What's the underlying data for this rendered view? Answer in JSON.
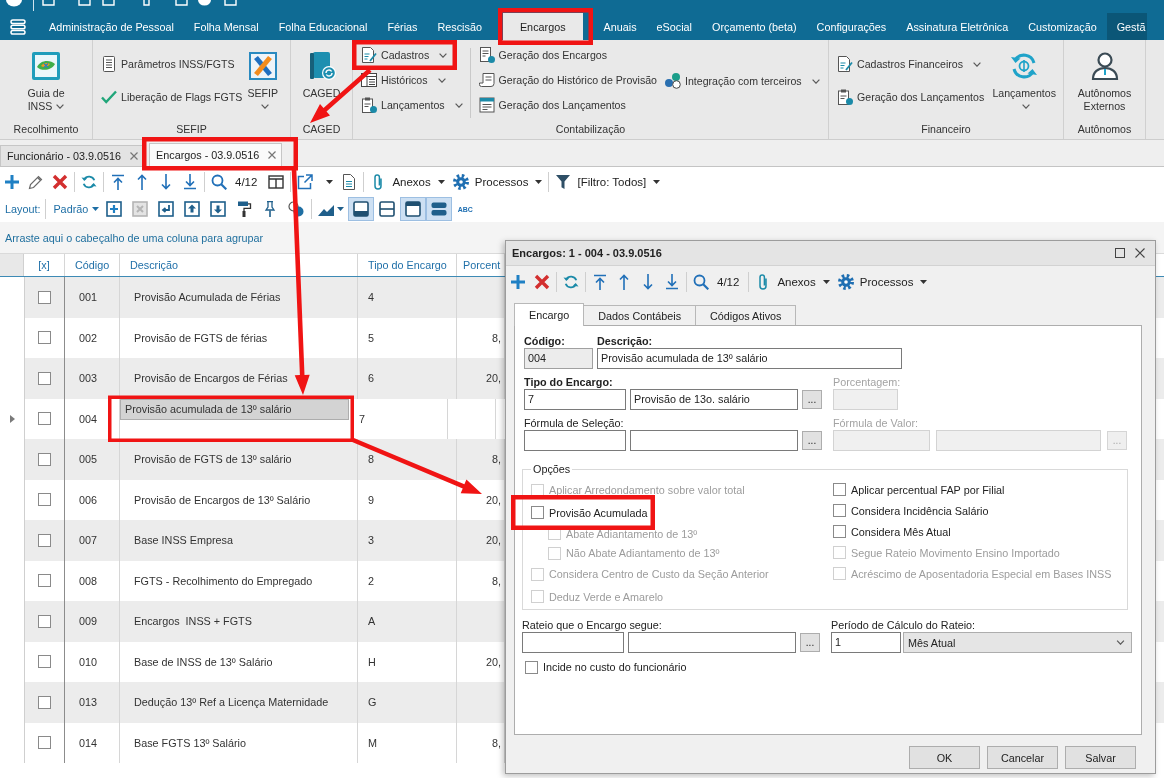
{
  "menu_tabs": [
    {
      "label": "Administração de Pessoal",
      "selected": false,
      "hovered": false
    },
    {
      "label": "Folha Mensal",
      "selected": false,
      "hovered": false
    },
    {
      "label": "Folha Educacional",
      "selected": false,
      "hovered": false
    },
    {
      "label": "Férias",
      "selected": false,
      "hovered": false
    },
    {
      "label": "Rescisão",
      "selected": false,
      "hovered": false
    },
    {
      "label": "Encargos",
      "selected": true,
      "hovered": false
    },
    {
      "label": "Anuais",
      "selected": false,
      "hovered": false
    },
    {
      "label": "eSocial",
      "selected": false,
      "hovered": false
    },
    {
      "label": "Orçamento (beta)",
      "selected": false,
      "hovered": false
    },
    {
      "label": "Configurações",
      "selected": false,
      "hovered": false
    },
    {
      "label": "Assinatura Eletrônica",
      "selected": false,
      "hovered": false
    },
    {
      "label": "Customização",
      "selected": false,
      "hovered": false
    },
    {
      "label": "Gestã",
      "selected": false,
      "hovered": true
    }
  ],
  "ribbon": {
    "recolhimento": {
      "label": "Recolhimento",
      "guia_inss": {
        "lines": [
          "Guia de",
          "INSS"
        ],
        "dropdown": true
      }
    },
    "sefip": {
      "label": "SEFIP",
      "parametros": {
        "label": "Parâmetros INSS/FGTS",
        "dropdown": false
      },
      "liberacao": {
        "label": "Liberação de Flags FGTS",
        "dropdown": false
      },
      "sefip": {
        "lines": [
          "SEFIP"
        ],
        "dropdown": true
      }
    },
    "caged": {
      "label": "CAGED",
      "caged": {
        "lines": [
          "CAGED"
        ],
        "dropdown": false
      }
    },
    "contabilizacao": {
      "label": "Contabilização",
      "cadastros": {
        "label": "Cadastros",
        "dropdown": true
      },
      "historicos": {
        "label": "Históricos",
        "dropdown": true
      },
      "lancamentos": {
        "label": "Lançamentos",
        "dropdown": true
      },
      "geracao_encargos": {
        "label": "Geração dos Encargos",
        "dropdown": false
      },
      "geracao_historico": {
        "label": "Geração do Histórico de Provisão",
        "dropdown": false
      },
      "geracao_lancamentos": {
        "label": "Geração dos Lançamentos",
        "dropdown": false
      },
      "integracao": {
        "label": "Integração com terceiros",
        "dropdown": true
      }
    },
    "financeiro": {
      "label": "Financeiro",
      "cadastros": {
        "label": "Cadastros Financeiros",
        "dropdown": true
      },
      "geracao": {
        "label": "Geração dos Lançamentos",
        "dropdown": false
      },
      "lancamentos": {
        "lines": [
          "Lançamentos"
        ],
        "dropdown": true
      }
    },
    "autonomos": {
      "label": "Autônomos",
      "externos": {
        "lines": [
          "Autônomos",
          "Externos"
        ],
        "dropdown": false
      }
    }
  },
  "doc_tabs": [
    {
      "label": "Funcionário - 03.9.0516",
      "selected": false
    },
    {
      "label": "Encargos - 03.9.0516",
      "selected": true
    }
  ],
  "toolbar": {
    "position": "4/12",
    "export": {
      "dropdown": true
    },
    "attachments": {
      "label": "Anexos",
      "dropdown": true
    },
    "processes": {
      "label": "Processos",
      "dropdown": true
    },
    "filter": {
      "label": "[Filtro: Todos]",
      "dropdown": true
    }
  },
  "layout_bar": {
    "label": "Layout:",
    "preset": {
      "label": "Padrão",
      "dropdown": true
    },
    "chart": {
      "dropdown": true
    },
    "toggles": [
      {
        "selected": true
      },
      {
        "selected": false
      },
      {
        "selected": true
      },
      {
        "selected": true
      }
    ],
    "text_button": "ABC"
  },
  "group_hint": "Arraste aqui o cabeçalho de uma coluna para agrupar",
  "grid": {
    "columns": [
      "[x]",
      "Código",
      "Descrição",
      "Tipo do Encargo",
      "Porcent"
    ],
    "rows": [
      {
        "code": "001",
        "description": "Provisão Acumulada de Férias",
        "type": "4",
        "checked": false,
        "selected": false
      },
      {
        "code": "002",
        "description": "Provisão de FGTS de férias",
        "type": "5",
        "percent": "8,",
        "checked": false,
        "selected": false
      },
      {
        "code": "003",
        "description": "Provisão de Encargos de Férias",
        "type": "6",
        "percent": "20,",
        "checked": false,
        "selected": false
      },
      {
        "code": "004",
        "description": "Provisão acumulada de 13º salário",
        "type": "7",
        "checked": false,
        "selected": true
      },
      {
        "code": "005",
        "description": "Provisão de FGTS de 13º salário",
        "type": "8",
        "percent": "8,",
        "checked": false,
        "selected": false
      },
      {
        "code": "006",
        "description": "Provisão de Encargos de 13º Salário",
        "type": "9",
        "percent": "20,",
        "checked": false,
        "selected": false
      },
      {
        "code": "007",
        "description": "Base INSS Empresa",
        "type": "3",
        "percent": "20,",
        "checked": false,
        "selected": false
      },
      {
        "code": "008",
        "description": "FGTS - Recolhimento do Empregado",
        "type": "2",
        "percent": "8,",
        "checked": false,
        "selected": false
      },
      {
        "code": "009",
        "description": "Encargos  INSS + FGTS",
        "type": "A",
        "checked": false,
        "selected": false
      },
      {
        "code": "010",
        "description": "Base de INSS de 13º Salário",
        "type": "H",
        "percent": "20,",
        "checked": false,
        "selected": false
      },
      {
        "code": "013",
        "description": "Dedução 13º Ref a Licença Maternidade",
        "type": "G",
        "checked": false,
        "selected": false
      },
      {
        "code": "014",
        "description": "Base FGTS 13º Salário",
        "type": "M",
        "percent": "8,",
        "checked": false,
        "selected": false
      }
    ]
  },
  "dialog": {
    "title": "Encargos: 1 - 004 - 03.9.0516",
    "toolbar": {
      "position": "4/12",
      "attachments": {
        "label": "Anexos",
        "dropdown": true
      },
      "processes": {
        "label": "Processos",
        "dropdown": true
      }
    },
    "tabs": [
      {
        "label": "Encargo",
        "selected": true
      },
      {
        "label": "Dados Contábeis",
        "selected": false
      },
      {
        "label": "Códigos Ativos",
        "selected": false
      }
    ],
    "codigo": {
      "label": "Código:",
      "required": true,
      "value": "004",
      "readonly": true
    },
    "descricao": {
      "label": "Descrição:",
      "required": true,
      "value": "Provisão acumulada de 13º salário",
      "readonly": false
    },
    "tipo": {
      "label": "Tipo do Encargo:",
      "required": true,
      "value": "7",
      "description": "Provisão de 13o. salário",
      "lookup": "...",
      "disabled": false
    },
    "porcentagem": {
      "label": "Porcentagem:",
      "required": false,
      "disabled": true
    },
    "formula_selecao": {
      "label": "Fórmula de Seleção:",
      "required": false,
      "lookup": "...",
      "disabled": false
    },
    "formula_valor": {
      "label": "Fórmula de Valor:",
      "required": false,
      "lookup": "...",
      "disabled": true
    },
    "opcoes": {
      "legend": "Opções",
      "left": [
        {
          "label": "Aplicar Arredondamento sobre valor total",
          "checked": false,
          "disabled": true
        },
        {
          "label": "Provisão Acumulada",
          "checked": false,
          "disabled": false,
          "children": [
            {
              "label": "Abate Adiantamento de 13º",
              "checked": false,
              "disabled": true
            },
            {
              "label": "Não Abate Adiantamento de 13º",
              "checked": false,
              "disabled": true
            }
          ]
        },
        {
          "label": "Considera Centro de Custo da Seção Anterior",
          "checked": false,
          "disabled": true
        },
        {
          "label": "Deduz Verde e Amarelo",
          "checked": false,
          "disabled": true
        }
      ],
      "right": [
        {
          "label": "Aplicar percentual FAP por Filial",
          "checked": false,
          "disabled": false
        },
        {
          "label": "Considera Incidência Salário",
          "checked": false,
          "disabled": false
        },
        {
          "label": "Considera Mês Atual",
          "checked": false,
          "disabled": false
        },
        {
          "label": "Segue Rateio Movimento Ensino Importado",
          "checked": false,
          "disabled": true
        },
        {
          "label": "Acréscimo de Aposentadoria Especial em Bases INSS",
          "checked": false,
          "disabled": true
        }
      ]
    },
    "rateio": {
      "label": "Rateio que o Encargo segue:",
      "required": false,
      "lookup": "...",
      "disabled": false
    },
    "periodo": {
      "label": "Período de Cálculo do Rateio:",
      "required": false,
      "value": "1",
      "option": "Mês Atual",
      "disabled": false
    },
    "incide": {
      "label": "Incide no custo do funcionário",
      "checked": false,
      "disabled": false
    },
    "buttons": [
      "OK",
      "Cancelar",
      "Salvar"
    ]
  }
}
